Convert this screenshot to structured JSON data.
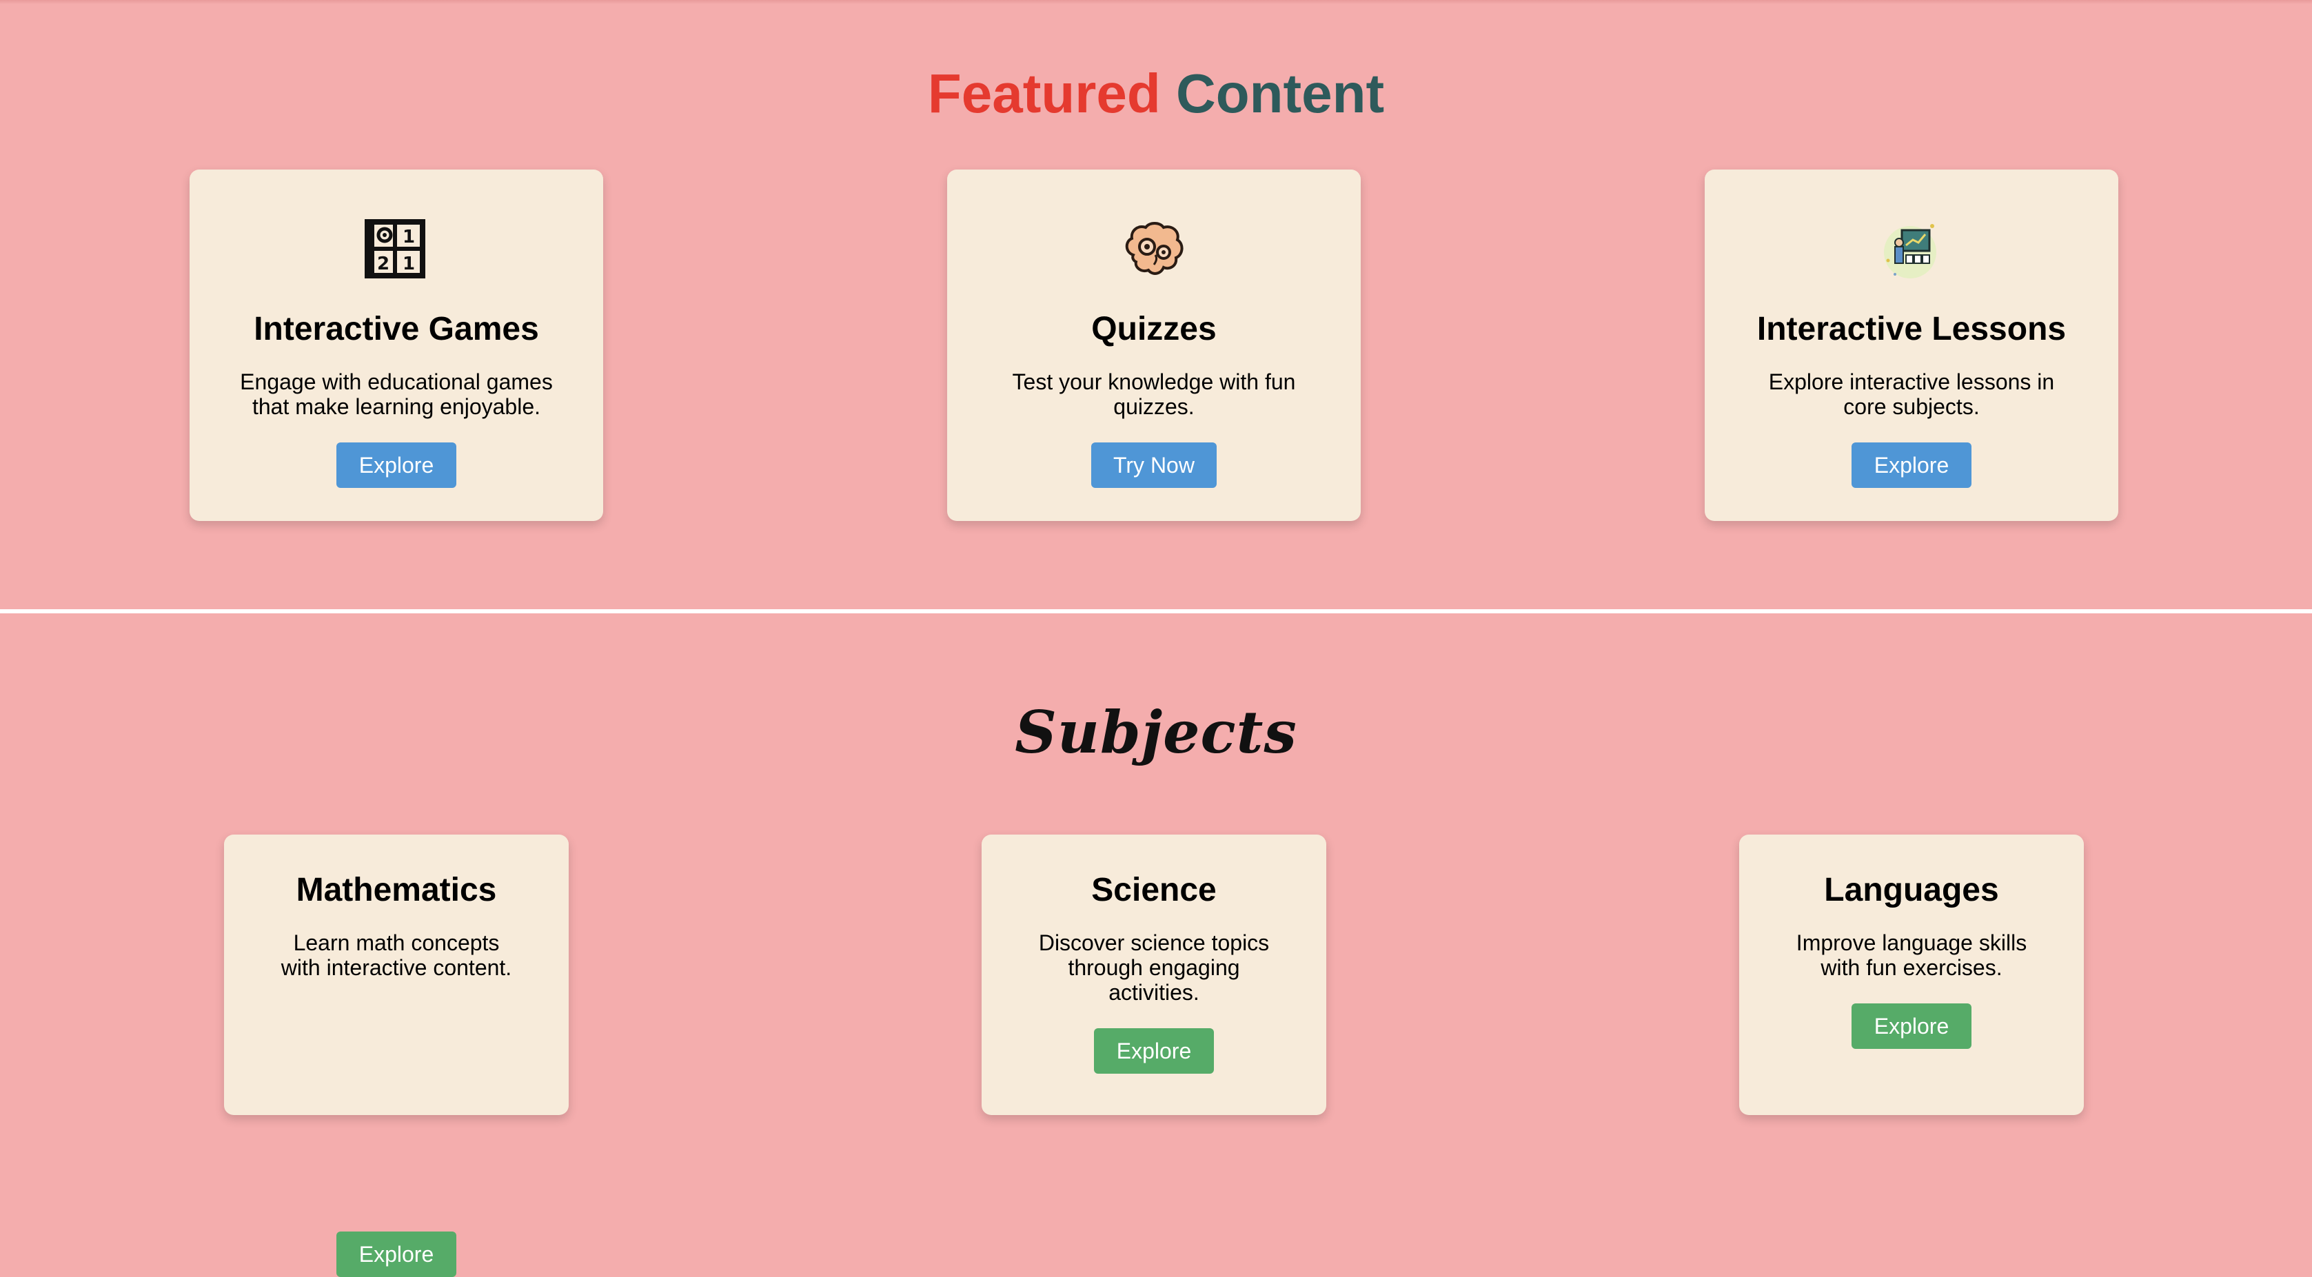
{
  "featured": {
    "title_part1": "Featured",
    "title_part2": "Content",
    "cards": [
      {
        "icon": "puzzle-grid-icon",
        "title": "Interactive Games",
        "desc": "Engage with educational games that make learning enjoyable.",
        "button": "Explore"
      },
      {
        "icon": "brain-gears-icon",
        "title": "Quizzes",
        "desc": "Test your knowledge with fun quizzes.",
        "button": "Try Now"
      },
      {
        "icon": "lesson-board-icon",
        "title": "Interactive Lessons",
        "desc": "Explore interactive lessons in core subjects.",
        "button": "Explore"
      }
    ]
  },
  "subjects": {
    "title": "Subjects",
    "cards": [
      {
        "title": "Mathematics",
        "desc": "Learn math concepts with interactive content.",
        "button": "Explore"
      },
      {
        "title": "Science",
        "desc": "Discover science topics through engaging activities.",
        "button": "Explore"
      },
      {
        "title": "Languages",
        "desc": "Improve language skills with fun exercises.",
        "button": "Explore"
      }
    ]
  },
  "colors": {
    "background": "#f4adad",
    "card": "#f7ebda",
    "title_red": "#e53a2f",
    "title_teal": "#2e5a5b",
    "button_blue": "#4f96d6",
    "button_green": "#56ab68"
  }
}
